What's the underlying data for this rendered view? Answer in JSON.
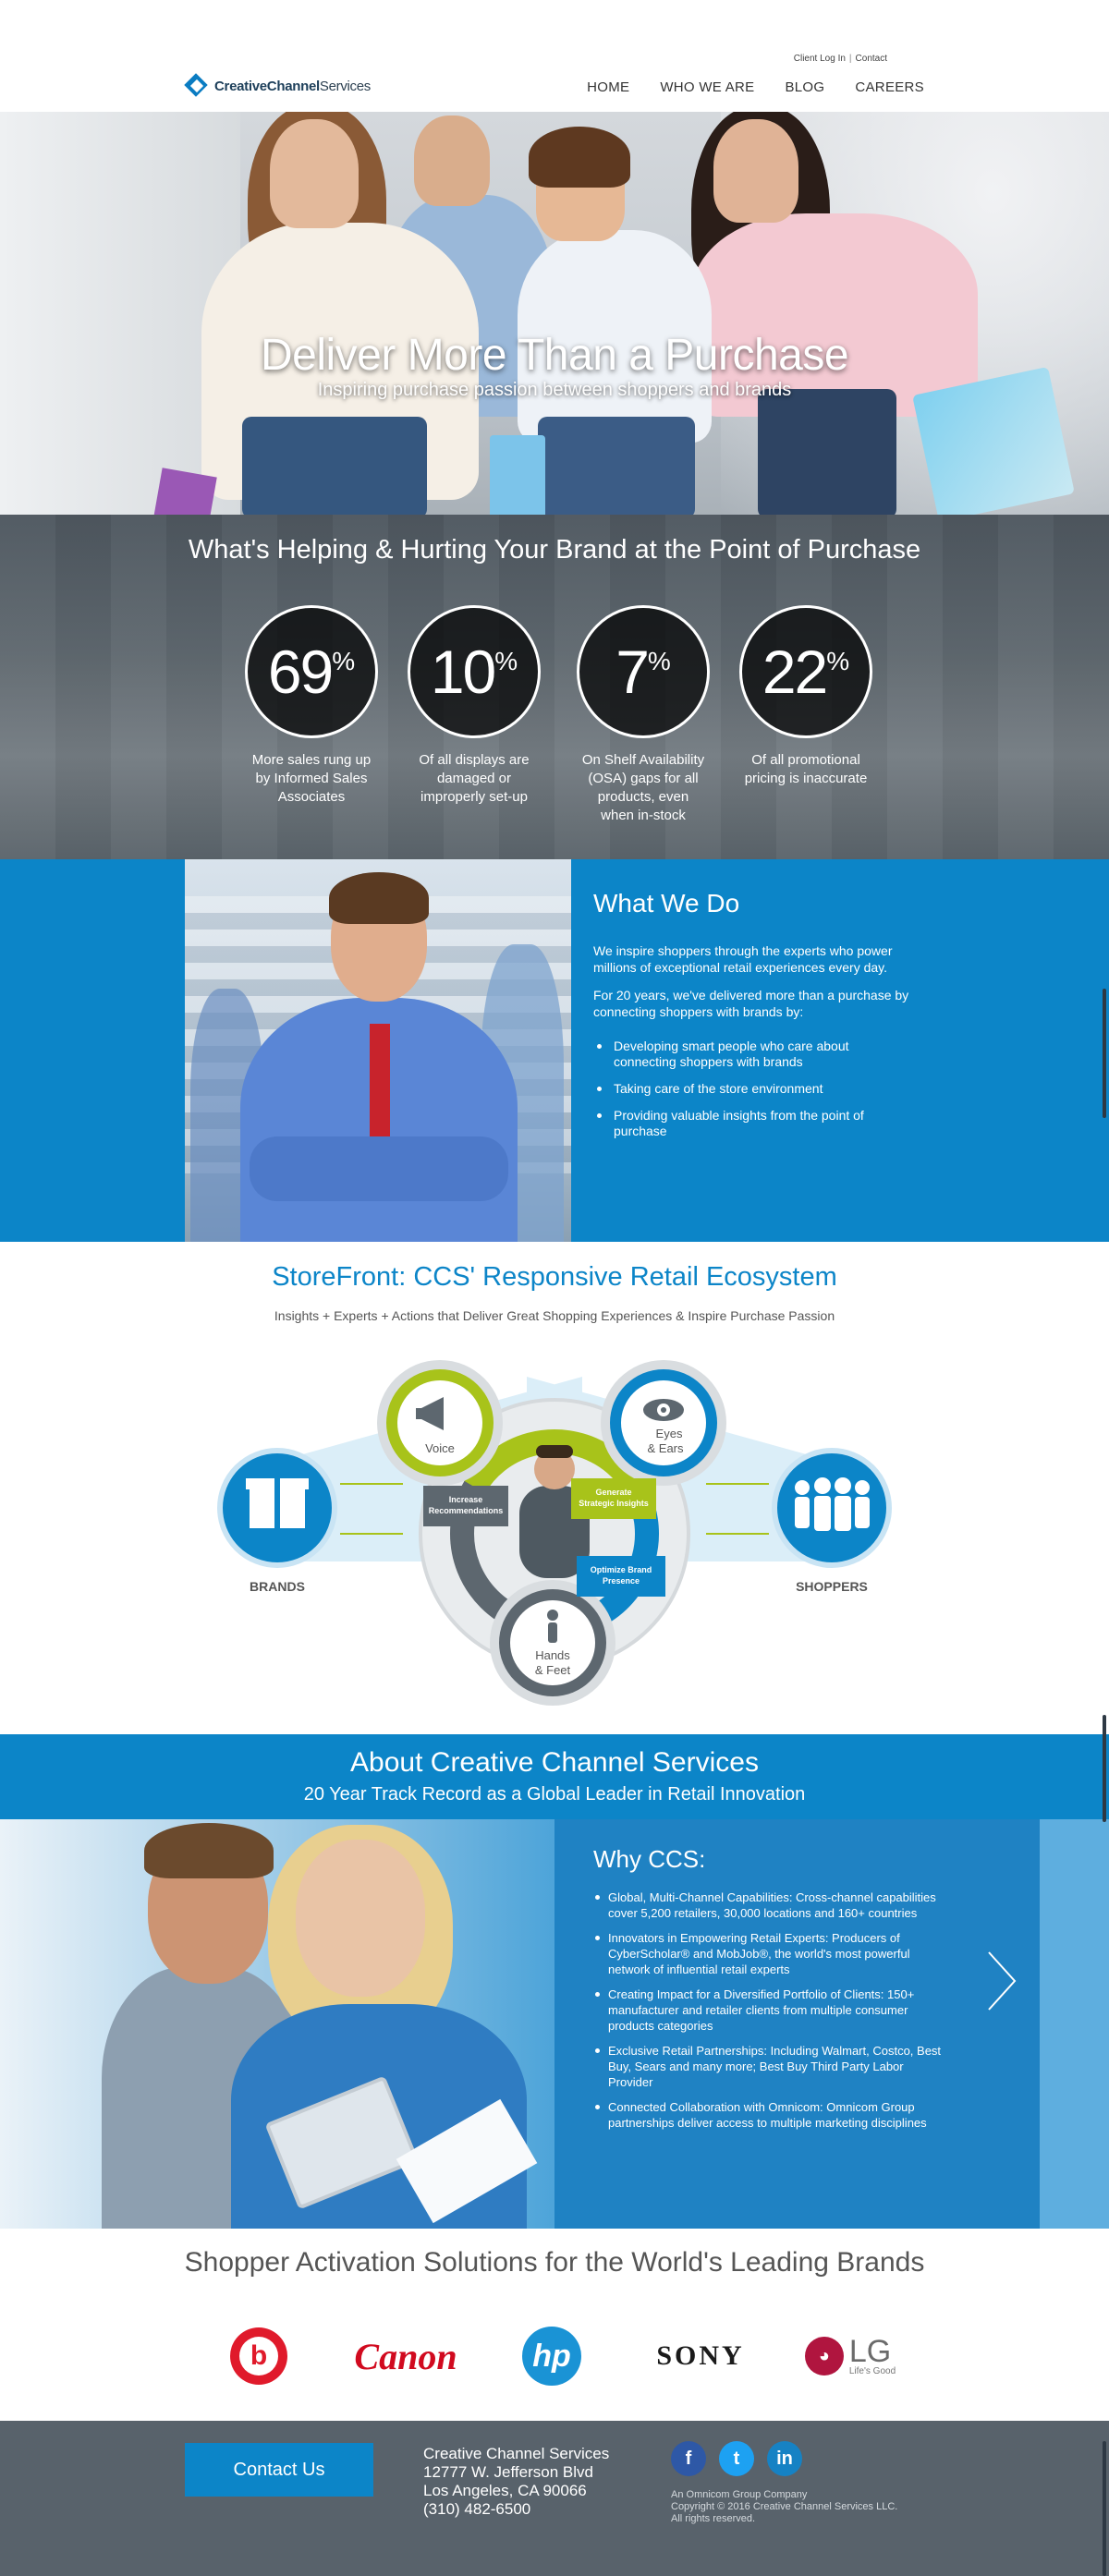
{
  "header": {
    "toplinks": {
      "login": "Client Log In",
      "sep": "|",
      "contact": "Contact"
    },
    "logo": {
      "bold": "CreativeChannel",
      "light": "Services"
    },
    "nav": [
      "HOME",
      "WHO WE ARE",
      "BLOG",
      "CAREERS"
    ]
  },
  "hero": {
    "title": "Deliver More Than a Purchase",
    "subtitle": "Inspiring purchase passion between shoppers and brands"
  },
  "stats": {
    "title": "What's Helping & Hurting Your Brand at the Point of Purchase",
    "items": [
      {
        "value": "69",
        "unit": "%",
        "label": "More sales rung up by Informed Sales Associates"
      },
      {
        "value": "10",
        "unit": "%",
        "label": "Of all displays are damaged or improperly set-up"
      },
      {
        "value": "7",
        "unit": "%",
        "label": "On Shelf Availability (OSA) gaps for all products, even when in-stock"
      },
      {
        "value": "22",
        "unit": "%",
        "label": "Of all promotional pricing is inaccurate"
      }
    ]
  },
  "what_we_do": {
    "title": "What We Do",
    "p1": "We inspire shoppers through the experts who power millions of exceptional retail experiences every day.",
    "p2": "For 20 years, we've delivered more than a purchase by connecting shoppers with brands by:",
    "bullets": [
      "Developing smart people who care about connecting shoppers with brands",
      "Taking care of the store environment",
      "Providing valuable insights from the point of purchase"
    ]
  },
  "storefront": {
    "title": "StoreFront: CCS' Responsive Retail Ecosystem",
    "subtitle": "Insights + Experts + Actions that Deliver Great Shopping Experiences & Inspire Purchase Passion",
    "brands": "BRANDS",
    "shoppers": "SHOPPERS",
    "voice": "Voice",
    "eyes_1": "Eyes",
    "eyes_2": "& Ears",
    "hands_1": "Hands",
    "hands_2": "& Feet",
    "tag_increase_1": "Increase",
    "tag_increase_2": "Recommendations",
    "tag_generate_1": "Generate",
    "tag_generate_2": "Strategic Insights",
    "tag_optimize_1": "Optimize Brand",
    "tag_optimize_2": "Presence"
  },
  "about": {
    "title": "About Creative Channel Services",
    "subtitle": "20 Year Track Record as a Global Leader in Retail Innovation",
    "why_title": "Why CCS:",
    "bullets": [
      "Global, Multi-Channel Capabilities: Cross-channel capabilities cover 5,200 retailers, 30,000 locations and 160+ countries",
      "Innovators in Empowering Retail Experts: Producers of CyberScholar® and MobJob®, the world's most powerful network of influential retail experts",
      "Creating Impact for a Diversified Portfolio of Clients: 150+ manufacturer and retailer clients from multiple consumer products categories",
      "Exclusive Retail Partnerships: Including Walmart, Costco, Best Buy, Sears and many more; Best Buy Third Party Labor Provider",
      "Connected Collaboration with Omnicom: Omnicom Group partnerships deliver access to multiple marketing disciplines"
    ]
  },
  "brands": {
    "title": "Shopper Activation Solutions for the World's Leading Brands",
    "beats": "b",
    "canon": "Canon",
    "hp": "hp",
    "sony": "SONY",
    "lg": "LG",
    "lg_mark": "◕",
    "lg_tagline": "Life's Good"
  },
  "footer": {
    "contact_button": "Contact Us",
    "address": [
      "Creative Channel Services",
      "12777 W. Jefferson Blvd",
      "Los Angeles, CA 90066",
      "(310) 482-6500"
    ],
    "social": {
      "facebook": "f",
      "twitter": "t",
      "linkedin": "in"
    },
    "fine": [
      "An Omnicom Group Company",
      "Copyright © 2016 Creative Channel Services LLC.",
      "All rights reserved."
    ]
  },
  "colors": {
    "brand_blue": "#0c85c8",
    "lime": "#a8c31a",
    "dark_gray": "#58626b"
  }
}
